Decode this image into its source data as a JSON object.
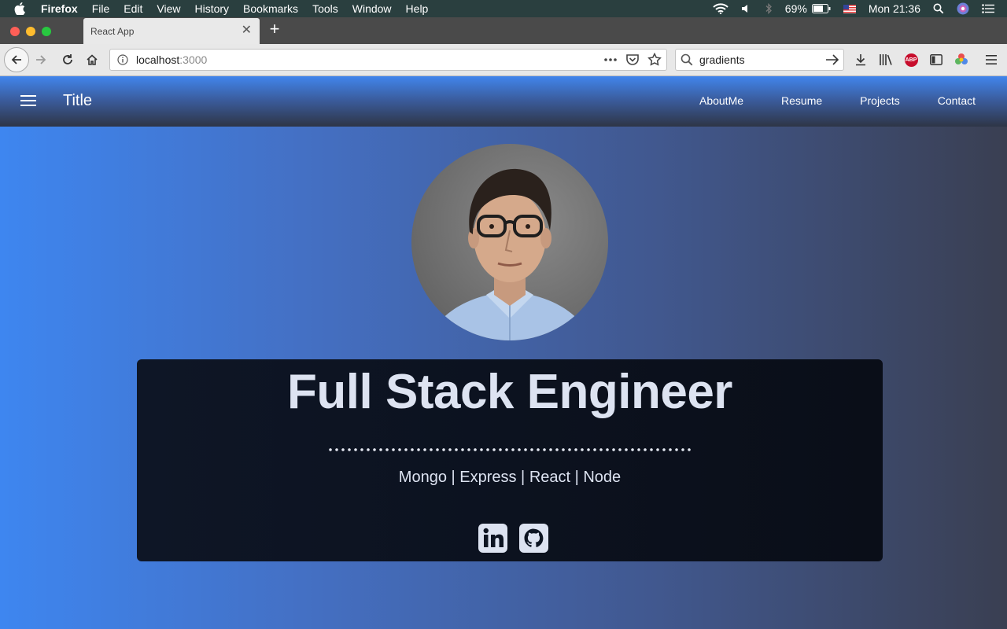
{
  "menubar": {
    "app_name": "Firefox",
    "items": [
      "File",
      "Edit",
      "View",
      "History",
      "Bookmarks",
      "Tools",
      "Window",
      "Help"
    ],
    "battery": "69%",
    "clock": "Mon 21:36"
  },
  "browser": {
    "tab_title": "React App",
    "url_host": "localhost",
    "url_port": ":3000",
    "search_query": "gradients"
  },
  "site": {
    "title": "Title",
    "nav": [
      "AboutMe",
      "Resume",
      "Projects",
      "Contact"
    ],
    "headline": "Full Stack Engineer",
    "tagline": "Mongo | Express | React | Node",
    "social": [
      "linkedin-icon",
      "github-icon"
    ]
  },
  "colors": {
    "menubar_bg": "#2a3f3f",
    "page_gradient_start": "#3e86f0",
    "page_gradient_end": "#3a3f52",
    "card_bg": "#0e1626",
    "headline_text": "#dde3f1"
  }
}
